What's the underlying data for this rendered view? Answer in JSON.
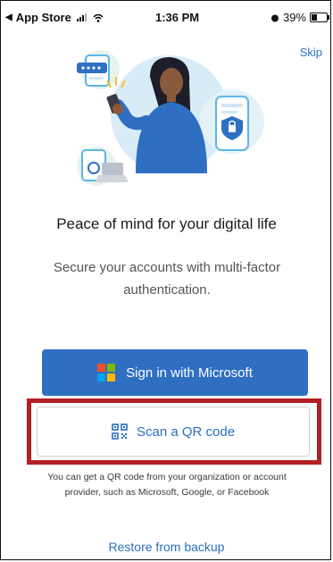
{
  "status_bar": {
    "back_label": "App Store",
    "time": "1:36 PM",
    "battery_text": "39%",
    "battery_level": 0.39
  },
  "header": {
    "skip_label": "Skip"
  },
  "main": {
    "title": "Peace of mind for your digital life",
    "subtitle": "Secure your accounts with multi-factor authentication."
  },
  "actions": {
    "signin_microsoft_label": "Sign in with Microsoft",
    "scan_qr_label": "Scan a QR code",
    "qr_hint": "You can get a QR code from your organization or account provider, such as Microsoft, Google, or Facebook",
    "restore_label": "Restore from backup"
  },
  "colors": {
    "accent_blue": "#2f6fc2",
    "link_blue": "#2a6fc0",
    "highlight_red": "#b41f24",
    "ms_red": "#f25022",
    "ms_green": "#7fba00",
    "ms_blue": "#00a4ef",
    "ms_yellow": "#ffb900"
  },
  "icons": {
    "signin_icon": "microsoft-logo-icon",
    "scan_icon": "qr-code-icon",
    "hero": "person-with-phone-illustration"
  }
}
